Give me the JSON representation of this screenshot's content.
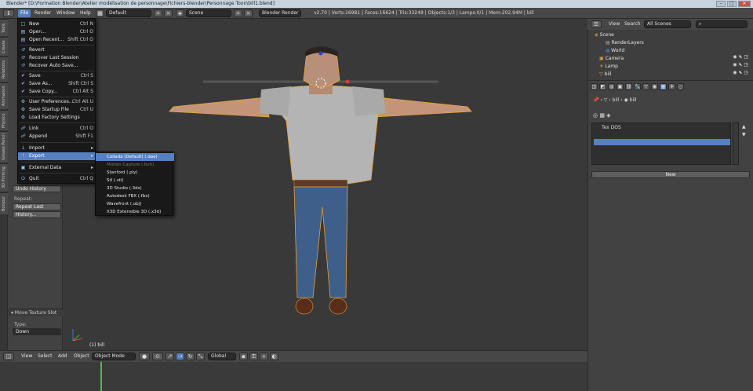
{
  "window": {
    "title": "Blender* [D:\\Formation Blender\\Atelier modélisation de personnage\\Fichiers-blender\\Personnage Toon\\bill1.blend]",
    "min": "–",
    "max": "□",
    "close": "✕"
  },
  "info": {
    "menus": [
      "File",
      "Render",
      "Window",
      "Help"
    ],
    "layout": "Default",
    "scene": "Scene",
    "engine": "Blender Render",
    "stats": "v2.70 | Verts:16981 | Faces:16624 | Tris:33248 | Objects:1/3 | Lamps:0/1 | Mem:202.94M | bill"
  },
  "tool_tabs": [
    "Tools",
    "Create",
    "Relations",
    "Animation",
    "Physics",
    "Grease Pencil",
    "3D Printing",
    "Bonjour"
  ],
  "toolshelf": {
    "undo_history": "Undo History",
    "repeat_label": "Repeat:",
    "repeat_last": "Repeat Last",
    "history": "History...",
    "operator": "▾ Move Texture Slot",
    "type_label": "Type:",
    "type_value": "Down"
  },
  "file_menu": {
    "items": [
      {
        "label": "New",
        "shortcut": "Ctrl N",
        "icon": "□"
      },
      {
        "label": "Open...",
        "shortcut": "Ctrl O",
        "icon": "▤"
      },
      {
        "label": "Open Recent...",
        "shortcut": "Shift Ctrl O",
        "icon": "▤"
      },
      {
        "label": "Revert",
        "shortcut": "",
        "icon": "↺"
      },
      {
        "label": "Recover Last Session",
        "shortcut": "",
        "icon": "↺"
      },
      {
        "label": "Recover Auto Save...",
        "shortcut": "",
        "icon": "↺"
      },
      {
        "label": "Save",
        "shortcut": "Ctrl S",
        "icon": "✔"
      },
      {
        "label": "Save As...",
        "shortcut": "Shift Ctrl S",
        "icon": "✔"
      },
      {
        "label": "Save Copy...",
        "shortcut": "Ctrl Alt S",
        "icon": "✔"
      },
      {
        "label": "User Preferences...",
        "shortcut": "Ctrl Alt U",
        "icon": "⚙"
      },
      {
        "label": "Save Startup File",
        "shortcut": "Ctrl U",
        "icon": "⚙"
      },
      {
        "label": "Load Factory Settings",
        "shortcut": "",
        "icon": "⚙"
      },
      {
        "label": "Link",
        "shortcut": "Ctrl O",
        "icon": "☍"
      },
      {
        "label": "Append",
        "shortcut": "Shift F1",
        "icon": "☍"
      },
      {
        "label": "Import",
        "shortcut": "▸",
        "icon": "↓"
      },
      {
        "label": "Export",
        "shortcut": "▸",
        "icon": "↑"
      },
      {
        "label": "External Data",
        "shortcut": "▸",
        "icon": "▣"
      },
      {
        "label": "Quit",
        "shortcut": "Ctrl Q",
        "icon": "⏻"
      }
    ]
  },
  "export_menu": {
    "items": [
      "Collada (Default) (.dae)",
      "Motion Capture (.bvh)",
      "Stanford (.ply)",
      "Stl (.stl)",
      "3D Studio (.3ds)",
      "Autodesk FBX (.fbx)",
      "Wavefront (.obj)",
      "X3D Extensible 3D (.x3d)"
    ]
  },
  "viewport": {
    "object_label": "(1) bill"
  },
  "bottom": {
    "menus": [
      "View",
      "Select",
      "Add",
      "Object"
    ],
    "mode": "Object Mode",
    "orientation": "Global"
  },
  "outliner": {
    "view": "View",
    "search": "Search",
    "scenes": "All Scenes",
    "rows": [
      "Scene",
      "RenderLayers",
      "World",
      "Camera",
      "Lamp",
      "bill"
    ]
  },
  "properties": {
    "breadcrumb_1": "bill",
    "breadcrumb_2": "bill",
    "tex_first": "Tex DOS",
    "new_label": "New"
  },
  "colors": {
    "accent": "#5680c2",
    "timeline_cursor": "#4fb94f"
  }
}
